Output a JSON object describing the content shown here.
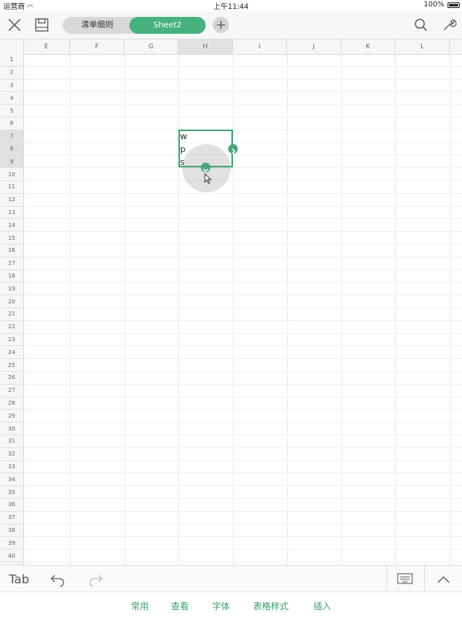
{
  "status": {
    "carrier": "运营商",
    "time": "上午11:44",
    "battery": "100%"
  },
  "sheet_tabs": [
    "清单细则",
    "Sheet2"
  ],
  "columns": [
    "E",
    "F",
    "G",
    "H",
    "I",
    "J",
    "K",
    "L"
  ],
  "rows": [
    "1",
    "2",
    "3",
    "4",
    "5",
    "6",
    "7",
    "8",
    "9",
    "10",
    "11",
    "12",
    "13",
    "14",
    "15",
    "16",
    "17",
    "18",
    "19",
    "20",
    "21",
    "22",
    "23",
    "24",
    "25",
    "26",
    "27",
    "28",
    "29",
    "30",
    "31",
    "32",
    "33",
    "34",
    "35",
    "36",
    "37",
    "38",
    "39",
    "40"
  ],
  "cells": {
    "H7": "w",
    "H8": "p",
    "H9": "s"
  },
  "bottom": {
    "tab_key": "Tab"
  },
  "menu": [
    "常用",
    "查看",
    "字体",
    "表格样式",
    "插入"
  ],
  "colors": {
    "accent": "#48b27e",
    "selection": "#4fa47a"
  }
}
